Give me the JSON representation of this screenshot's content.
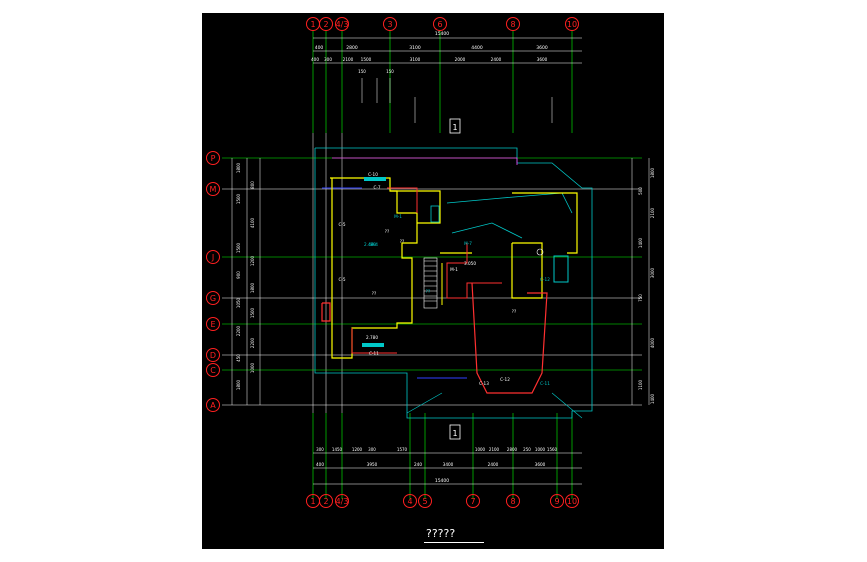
{
  "drawing": {
    "caption": "?????",
    "section_marker": "1",
    "colors": {
      "background": "#000000",
      "axis_bubble": "#ff2020",
      "dimension": "#ffffff",
      "grid_line": "#00ff00",
      "wall_yellow": "#ffff00",
      "wall_red": "#ff3030",
      "outline_cyan": "#00c8c8",
      "magenta": "#ff40ff",
      "blue": "#3040ff"
    },
    "top_axes": [
      "1",
      "2",
      "4/3",
      "3",
      "6",
      "8",
      "10"
    ],
    "bottom_axes": [
      "1",
      "2",
      "4/3",
      "4",
      "5",
      "7",
      "8",
      "9",
      "10"
    ],
    "left_axes": [
      "P",
      "M",
      "J",
      "G",
      "E",
      "D",
      "C",
      "A"
    ],
    "top_dim_total": "15400",
    "top_dim_row1": [
      "400",
      "2800",
      "3100",
      "4400",
      "3600"
    ],
    "top_dim_row2": [
      "400",
      "300",
      "2100",
      "1500",
      "3100",
      "2000",
      "2400",
      "3600"
    ],
    "top_dim_row3": [
      "150",
      "150"
    ],
    "bottom_dim_row1": [
      "300",
      "1450",
      "1200",
      "300",
      "1570",
      "1000",
      "2100",
      "2800",
      "250",
      "1000",
      "1560"
    ],
    "bottom_dim_row2": [
      "400",
      "3950",
      "240",
      "3400",
      "2400",
      "3600"
    ],
    "bottom_dim_total": "15400",
    "left_dims": [
      "1800",
      "800",
      "1500",
      "4100",
      "1500",
      "1200",
      "900",
      "1800",
      "1050",
      "1500",
      "2200",
      "2200",
      "450",
      "1000",
      "1800"
    ],
    "right_dims": [
      "1800",
      "500",
      "2100",
      "1400",
      "3000",
      "750",
      "4000",
      "1100",
      "1400"
    ],
    "room_labels": [
      "C-10",
      "C-7",
      "M-1",
      "C-5",
      "??",
      "M-4",
      "C-5",
      "??",
      "2.480",
      "??",
      "C-11",
      "M-7",
      "3.050",
      "M-1",
      "C-12",
      "C-13",
      "C-12",
      "C-11",
      "??",
      "2.780",
      "??"
    ]
  }
}
